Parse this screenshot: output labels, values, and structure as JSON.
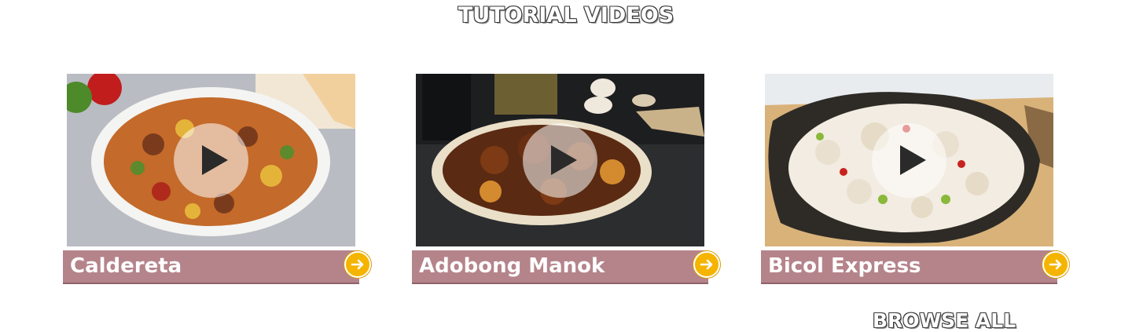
{
  "section": {
    "title": "TUTORIAL VIDEOS"
  },
  "videos": [
    {
      "title": "Caldereta"
    },
    {
      "title": "Adobong Manok"
    },
    {
      "title": "Bicol Express"
    }
  ],
  "footer": {
    "browse_all": "BROWSE ALL"
  },
  "colors": {
    "label_bar": "#b5848b",
    "arrow_button": "#f5b400",
    "play_overlay": "rgba(255,255,255,0.55)"
  },
  "icons": {
    "play": "play-icon",
    "arrow": "arrow-right-icon"
  }
}
